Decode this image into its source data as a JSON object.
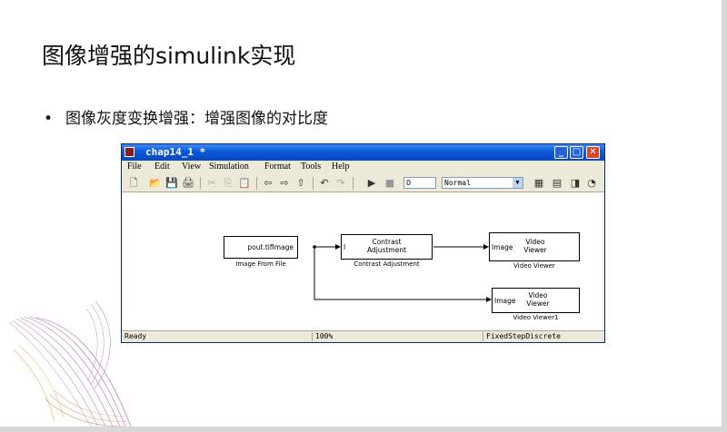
{
  "slide": {
    "title": "图像增强的simulink实现",
    "bullet_symbol": "•",
    "bullet": "图像灰度变换增强：增强图像的对比度"
  },
  "window": {
    "title": "chap14_1 *",
    "buttons": {
      "minimize": "_",
      "maximize": "□",
      "close": "✕"
    },
    "menu": [
      "File",
      "Edit",
      "View",
      "Simulation",
      "Format",
      "Tools",
      "Help"
    ],
    "toolbar": {
      "icons": [
        "new-icon",
        "open-icon",
        "save-icon",
        "print-icon",
        "cut-icon",
        "copy-icon",
        "paste-icon",
        "back-icon",
        "forward-icon",
        "up-icon",
        "undo-icon",
        "redo-icon",
        "play-icon",
        "stop-icon",
        "library-browser-icon",
        "model-explorer-icon",
        "debug-icon",
        "update-icon"
      ],
      "stop_time": "0",
      "sim_mode": "Normal"
    },
    "blocks": {
      "image_from_file": {
        "text": "pout.tifImage",
        "label": "Image From File"
      },
      "contrast": {
        "text_line1": "Contrast",
        "text_line2": "Adjustment",
        "input_port": "I",
        "label": "Contrast Adjustment"
      },
      "viewer1": {
        "port": "Image",
        "text_line1": "Video",
        "text_line2": "Viewer",
        "label": "Video Viewer"
      },
      "viewer2": {
        "port": "Image",
        "text_line1": "Video",
        "text_line2": "Viewer",
        "label": "Video Viewer1"
      }
    },
    "status": {
      "state": "Ready",
      "zoom": "100%",
      "solver": "FixedStepDiscrete"
    }
  },
  "colors": {
    "titlebar": "#0a58d8",
    "chrome": "#ece9d8",
    "close": "#d8462a"
  }
}
